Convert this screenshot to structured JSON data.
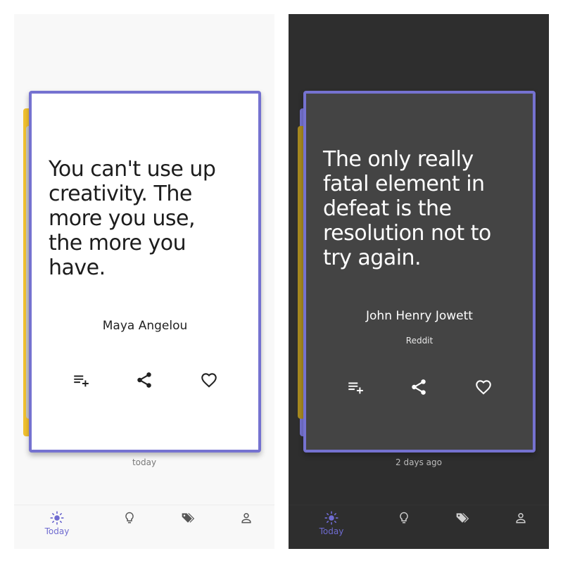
{
  "accent_color": "#7572d0",
  "back_card_color": "#f2c230",
  "light_screen": {
    "quote": {
      "lines": [
        "You can't use up",
        "creativity. The",
        "more you use,",
        "the more you",
        "have."
      ],
      "author": "Maya Angelou"
    },
    "actions": [
      "add-to-playlist-icon",
      "share-icon",
      "heart-icon"
    ],
    "timestamp": "today",
    "nav": {
      "today_label": "Today",
      "items": [
        "sun-icon",
        "lightbulb-icon",
        "tags-icon",
        "person-icon"
      ]
    }
  },
  "dark_screen": {
    "quote": {
      "lines": [
        "The only really",
        "fatal element in",
        "defeat is the",
        "resolution not to",
        "try again."
      ],
      "author": "John Henry Jowett",
      "source": "Reddit"
    },
    "actions": [
      "add-to-playlist-icon",
      "share-icon",
      "heart-icon"
    ],
    "timestamp": "2 days ago",
    "nav": {
      "today_label": "Today",
      "items": [
        "sun-icon",
        "lightbulb-icon",
        "tags-icon",
        "person-icon"
      ]
    }
  }
}
